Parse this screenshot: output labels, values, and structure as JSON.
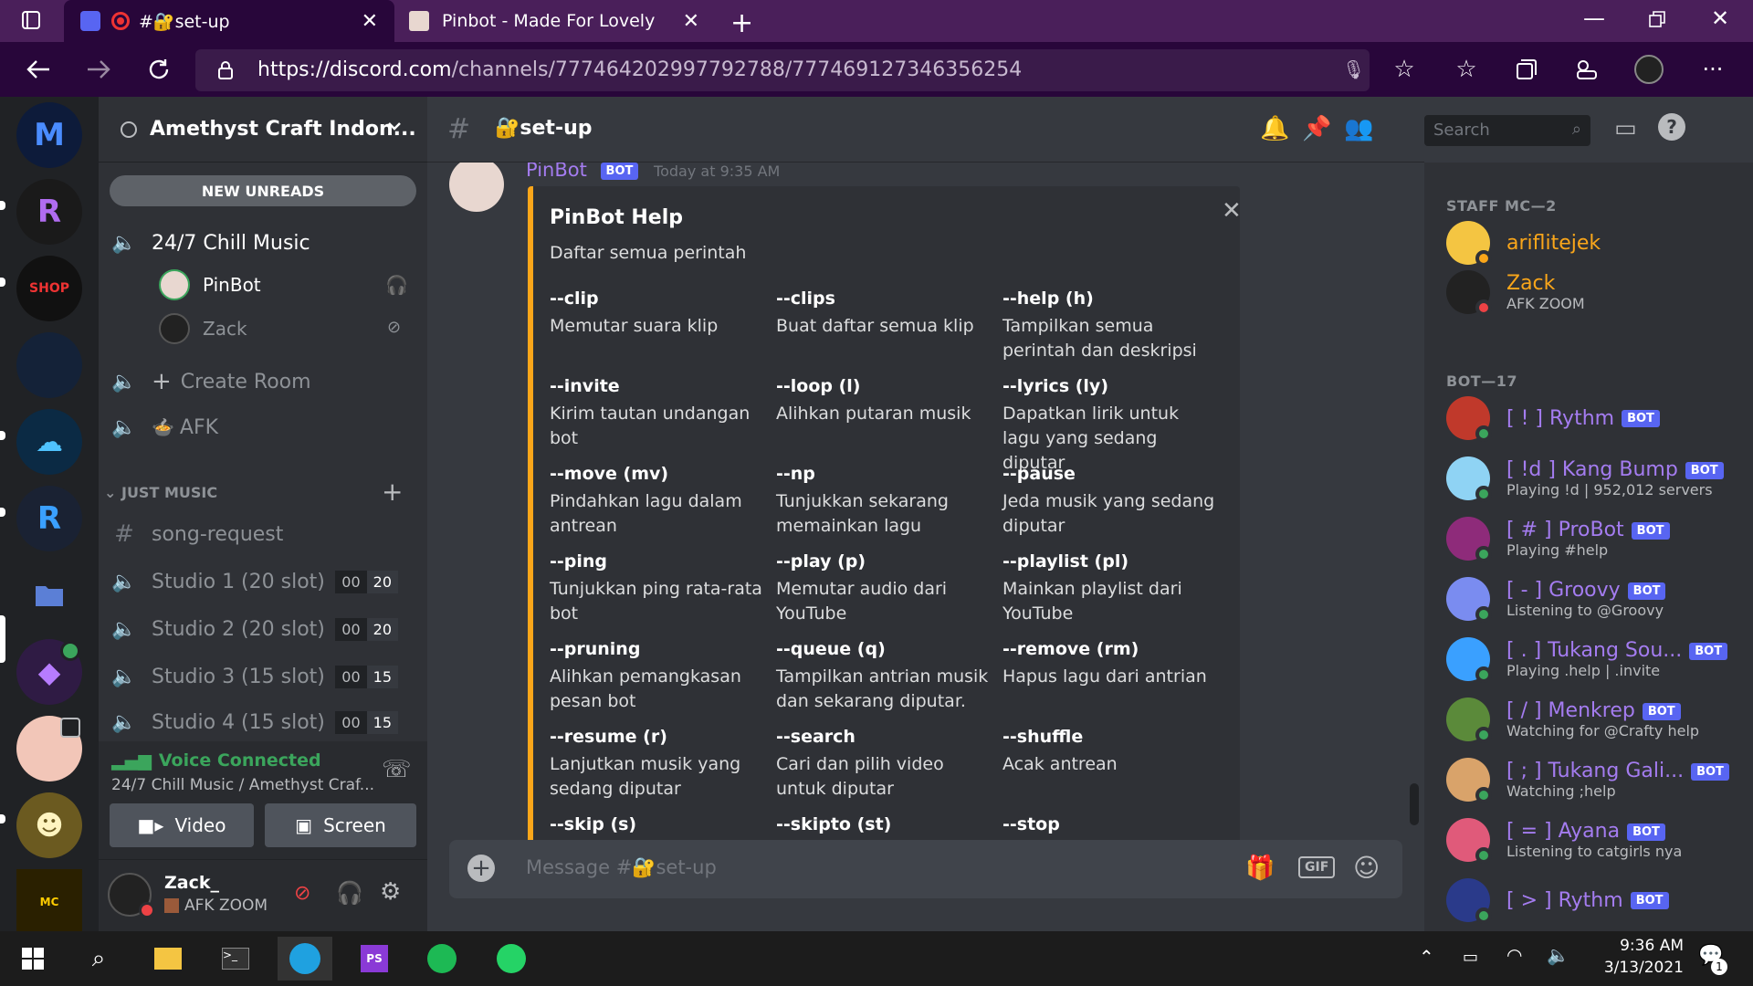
{
  "browser": {
    "tabs": [
      {
        "label": "#🔐set-up",
        "active": true
      },
      {
        "label": "Pinbot - Made For Lovely",
        "active": false
      }
    ],
    "url_host": "https://discord.com",
    "url_path": "/channels/777464202997792788/777469127346356254"
  },
  "server": {
    "name": "Amethyst Craft Indon...",
    "new_unreads": "NEW UNREADS",
    "voice_channel": "24/7 Chill Music",
    "voice_users": [
      {
        "name": "PinBot",
        "muted_icon": "deafen-red-icon"
      },
      {
        "name": "Zack",
        "muted_icon": "mic-muted-icon"
      }
    ],
    "create_room": "Create Room",
    "afk": "AFK",
    "category": "JUST MUSIC",
    "song_request": "song-request",
    "studios": [
      {
        "name": "Studio 1 (20 slot)",
        "count": "00",
        "limit": "20"
      },
      {
        "name": "Studio 2 (20 slot)",
        "count": "00",
        "limit": "20"
      },
      {
        "name": "Studio 3 (15 slot)",
        "count": "00",
        "limit": "15"
      },
      {
        "name": "Studio 4 (15 slot)",
        "count": "00",
        "limit": "15"
      }
    ]
  },
  "voice_panel": {
    "status": "Voice Connected",
    "location": "24/7 Chill Music / Amethyst Craf...",
    "video": "Video",
    "screen": "Screen"
  },
  "user_panel": {
    "name": "Zack_",
    "status": "AFK ZOOM"
  },
  "chat": {
    "channel": "set-up",
    "search_placeholder": "Search",
    "author": "PinBot",
    "bot_tag": "BOT",
    "timestamp": "Today at 9:35 AM",
    "embed_title": "PinBot Help",
    "embed_desc": "Daftar semua perintah",
    "commands": [
      {
        "name": "--clip",
        "desc": "Memutar suara klip"
      },
      {
        "name": "--clips",
        "desc": "Buat daftar semua klip"
      },
      {
        "name": "--help (h)",
        "desc": "Tampilkan semua perintah dan deskripsi"
      },
      {
        "name": "--invite",
        "desc": "Kirim tautan undangan bot"
      },
      {
        "name": "--loop (l)",
        "desc": "Alihkan putaran musik"
      },
      {
        "name": "--lyrics (ly)",
        "desc": "Dapatkan lirik untuk lagu yang sedang diputar"
      },
      {
        "name": "--move (mv)",
        "desc": "Pindahkan lagu dalam antrean"
      },
      {
        "name": "--np",
        "desc": "Tunjukkan sekarang memainkan lagu"
      },
      {
        "name": "--pause",
        "desc": "Jeda musik yang sedang diputar"
      },
      {
        "name": "--ping",
        "desc": "Tunjukkan ping rata-rata bot"
      },
      {
        "name": "--play (p)",
        "desc": "Memutar audio dari YouTube"
      },
      {
        "name": "--playlist (pl)",
        "desc": "Mainkan playlist dari YouTube"
      },
      {
        "name": "--pruning",
        "desc": "Alihkan pemangkasan pesan bot"
      },
      {
        "name": "--queue (q)",
        "desc": "Tampilkan antrian musik dan sekarang diputar."
      },
      {
        "name": "--remove (rm)",
        "desc": "Hapus lagu dari antrian"
      },
      {
        "name": "--resume (r)",
        "desc": "Lanjutkan musik yang sedang diputar"
      },
      {
        "name": "--search",
        "desc": "Cari dan pilih video untuk diputar"
      },
      {
        "name": "--shuffle",
        "desc": "Acak antrean"
      },
      {
        "name": "--skip (s)",
        "desc": ""
      },
      {
        "name": "--skipto (st)",
        "desc": ""
      },
      {
        "name": "--stop",
        "desc": ""
      }
    ],
    "message_placeholder": "Message #🔐set-up",
    "gif": "GIF"
  },
  "members": {
    "staff_header": "STAFF MC—2",
    "staff": [
      {
        "name": "ariflitejek",
        "sub": "",
        "color": "#faa61a"
      },
      {
        "name": "Zack",
        "sub": "AFK ZOOM",
        "color": "#faa61a"
      }
    ],
    "bot_header": "BOT—17",
    "bots": [
      {
        "name": "[ ! ] Rythm",
        "sub": "",
        "color": "#a47cf0"
      },
      {
        "name": "[ !d ] Kang Bump",
        "sub": "Playing !d | 952,012 servers",
        "color": "#a47cf0"
      },
      {
        "name": "[ # ] ProBot",
        "sub": "Playing #help",
        "color": "#a47cf0"
      },
      {
        "name": "[ - ] Groovy",
        "sub": "Listening to @Groovy",
        "color": "#a47cf0"
      },
      {
        "name": "[ . ] Tukang Sou...",
        "sub": "Playing .help | .invite",
        "color": "#a47cf0"
      },
      {
        "name": "[ / ] Menkrep",
        "sub": "Watching for @Crafty help",
        "color": "#a47cf0"
      },
      {
        "name": "[ ; ] Tukang Gali...",
        "sub": "Watching ;help",
        "color": "#a47cf0"
      },
      {
        "name": "[ = ] Ayana",
        "sub": "Listening to catgirls nya",
        "color": "#a47cf0"
      },
      {
        "name": "[ > ] Rythm",
        "sub": "",
        "color": "#a47cf0"
      }
    ]
  },
  "taskbar": {
    "time": "9:36 AM",
    "date": "3/13/2021",
    "notification_count": "1"
  }
}
